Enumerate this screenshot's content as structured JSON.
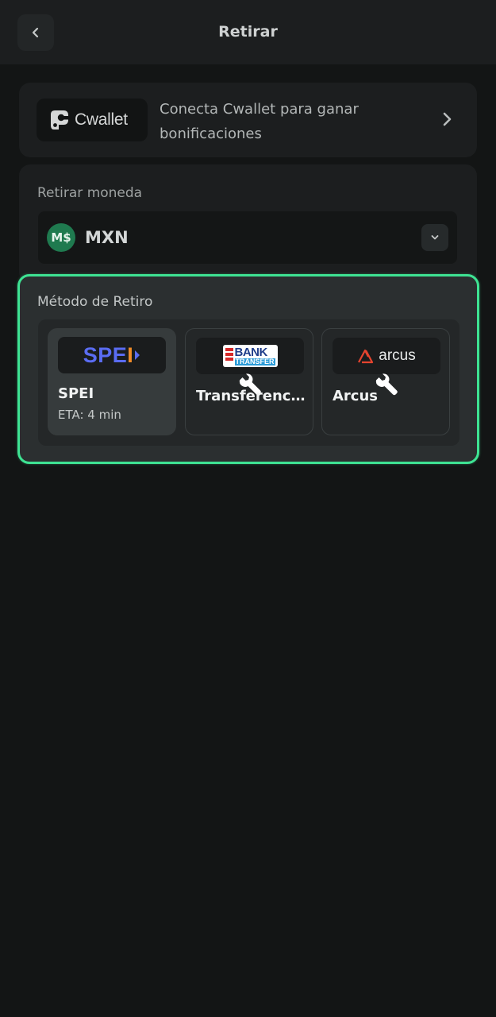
{
  "header": {
    "title": "Retirar",
    "back_icon": "chevron-left-icon"
  },
  "cwallet": {
    "logo_text": "Cwallet",
    "message_line1": "Conecta Cwallet para ganar",
    "message_line2": "bonificaciones",
    "chevron_icon": "chevron-right-icon"
  },
  "currency": {
    "label": "Retirar moneda",
    "icon_text": "M$",
    "code": "MXN",
    "icon_color": "#1f7a4f"
  },
  "method": {
    "label": "Método de Retiro",
    "accent_color": "#3ee393",
    "options": [
      {
        "logo_text_main": "SPE",
        "logo_text_accent": "I",
        "title": "SPEI",
        "eta": "ETA: 4 min",
        "selected": true,
        "under_maintenance": false
      },
      {
        "logo_line1": "BANK",
        "logo_line2": "TRANSFER",
        "title": "Transferencia bancaria",
        "selected": false,
        "under_maintenance": true,
        "status_icon": "wrench-icon"
      },
      {
        "logo_text": "arcus",
        "title": "Arcus",
        "selected": false,
        "under_maintenance": true,
        "status_icon": "wrench-icon"
      }
    ]
  }
}
